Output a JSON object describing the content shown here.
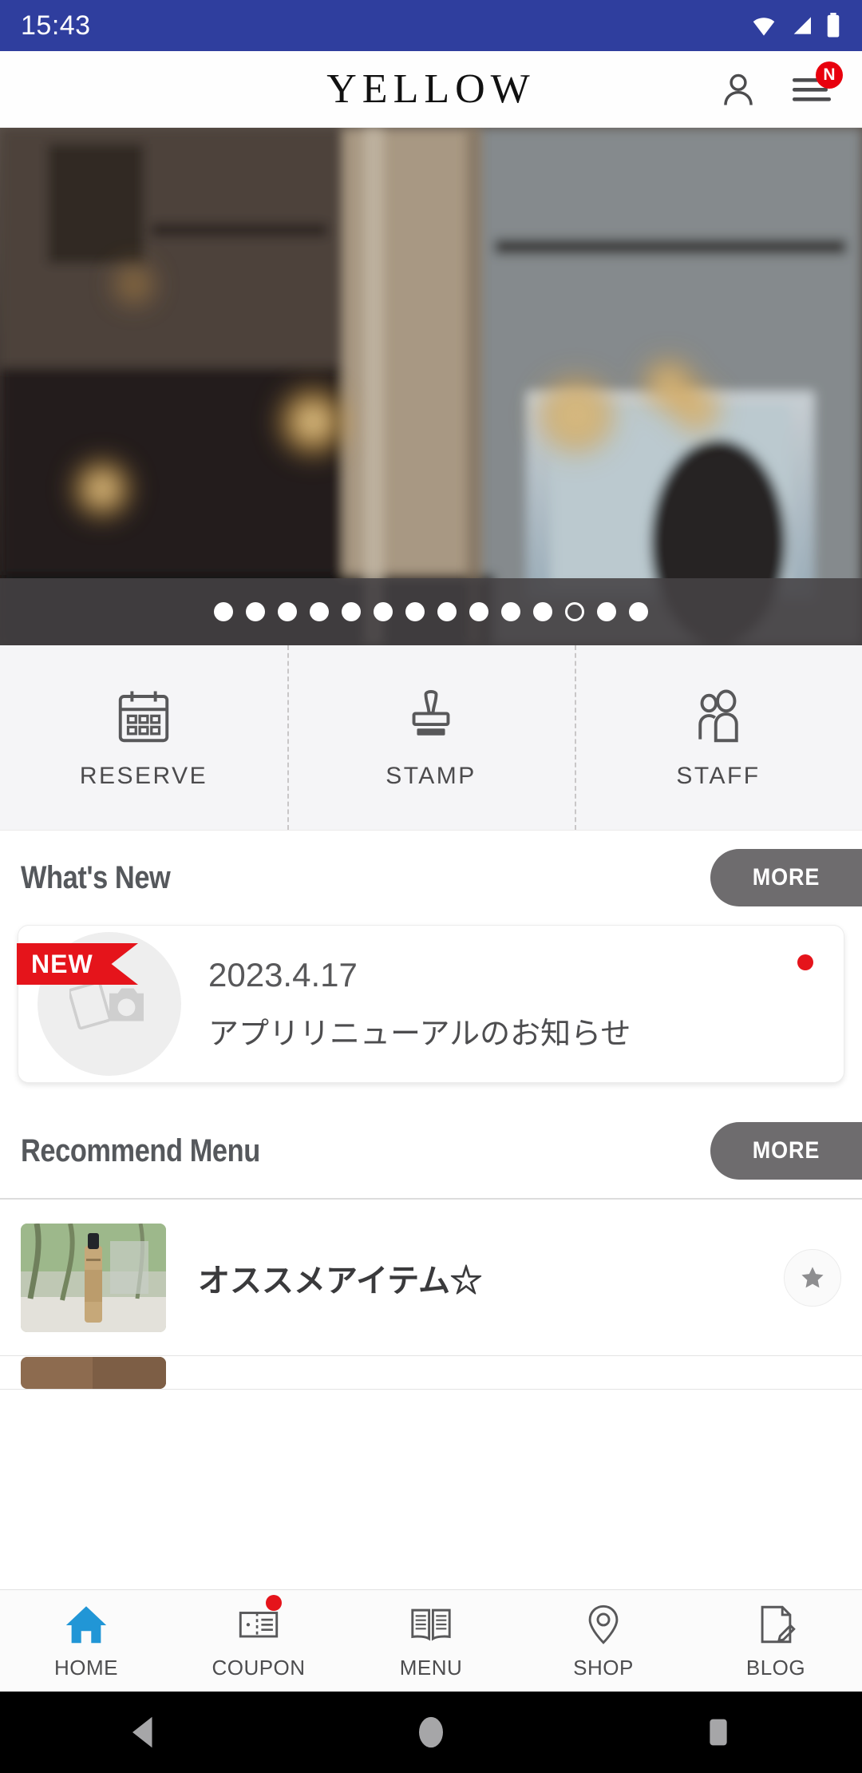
{
  "statusbar": {
    "time": "15:43",
    "icons": [
      "wifi-icon",
      "signal-icon",
      "battery-icon"
    ],
    "background_color": "#2f3e9e"
  },
  "header": {
    "logo": "YELLOW",
    "account_icon": "person-icon",
    "menu_icon": "hamburger-menu-icon",
    "menu_badge": "N",
    "badge_color": "#e8000d"
  },
  "hero": {
    "alt": "salon interior with pendant lights and bright window",
    "carousel": {
      "total_dots": 14,
      "active_index": 11
    }
  },
  "quick_actions": [
    {
      "label": "RESERVE",
      "icon": "calendar-icon"
    },
    {
      "label": "STAMP",
      "icon": "stamp-icon"
    },
    {
      "label": "STAFF",
      "icon": "people-icon"
    }
  ],
  "whats_new": {
    "title": "What's New",
    "more_label": "MORE",
    "items": [
      {
        "ribbon": "NEW",
        "date": "2023.4.17",
        "text": "アプリリニューアルのお知らせ",
        "thumb_icon": "photo-placeholder-icon",
        "unread": true
      }
    ]
  },
  "recommend_menu": {
    "title": "Recommend Menu",
    "more_label": "MORE",
    "items": [
      {
        "title": "オススメアイテム☆",
        "thumb_alt": "hair oil bottle outdoors",
        "star_icon": "star-icon"
      }
    ]
  },
  "bottom_nav": {
    "items": [
      {
        "label": "HOME",
        "icon": "home-icon",
        "active": true,
        "badge": false
      },
      {
        "label": "COUPON",
        "icon": "coupon-icon",
        "active": false,
        "badge": true
      },
      {
        "label": "MENU",
        "icon": "book-icon",
        "active": false,
        "badge": false
      },
      {
        "label": "SHOP",
        "icon": "pin-icon",
        "active": false,
        "badge": false
      },
      {
        "label": "BLOG",
        "icon": "blog-icon",
        "active": false,
        "badge": false
      }
    ],
    "active_color": "#2196d6"
  },
  "system_nav": {
    "back": "back-triangle-icon",
    "home": "home-circle-icon",
    "recents": "recents-square-icon"
  }
}
